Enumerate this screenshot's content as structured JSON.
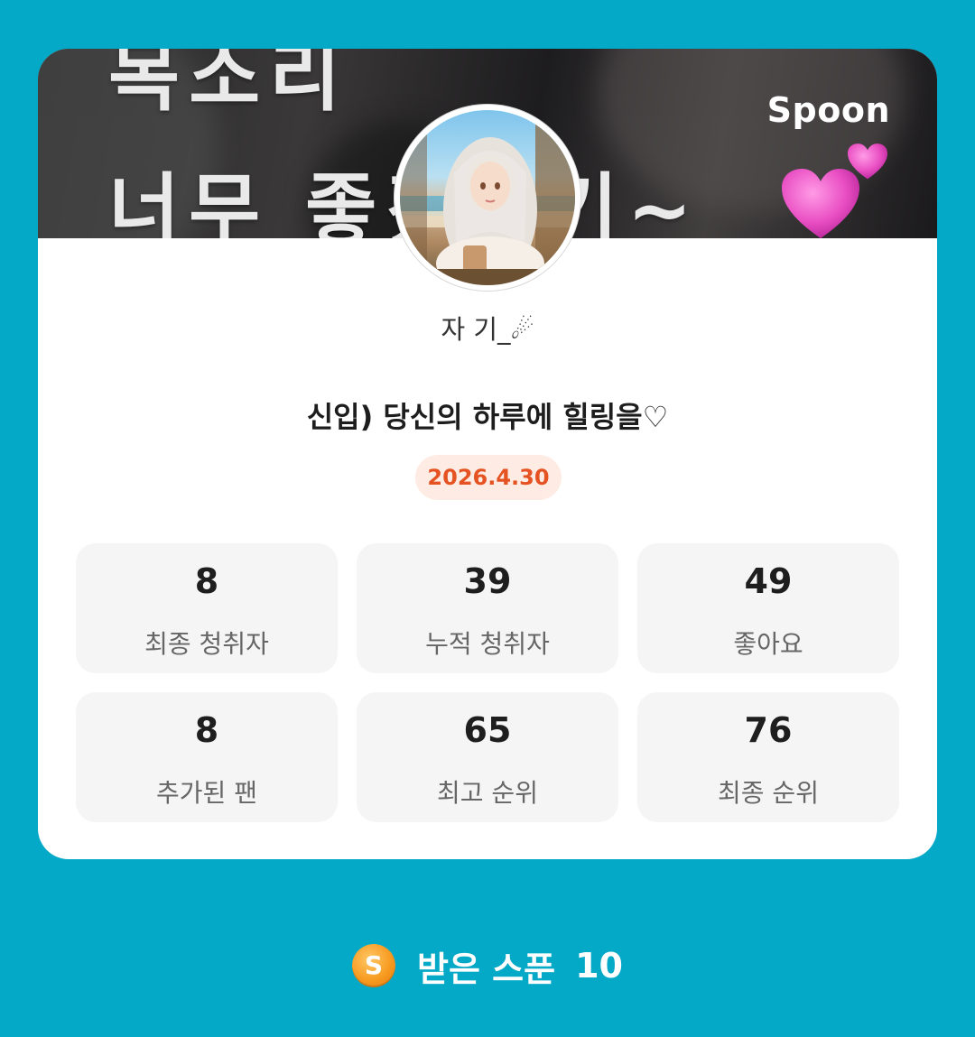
{
  "card": {
    "banner": {
      "line1": "목소리",
      "line2": "너무 좋겠쟈기~",
      "brand": "Spoon"
    },
    "nickname": "자 기_☄",
    "title": "신입) 당신의 하루에 힐링을♡",
    "date": "2026.4.30",
    "stats": [
      {
        "value": "8",
        "label": "최종 청취자"
      },
      {
        "value": "39",
        "label": "누적 청취자"
      },
      {
        "value": "49",
        "label": "좋아요"
      },
      {
        "value": "8",
        "label": "추가된 팬"
      },
      {
        "value": "65",
        "label": "최고 순위"
      },
      {
        "value": "76",
        "label": "최종 순위"
      }
    ]
  },
  "footer": {
    "coin_letter": "S",
    "label": "받은 스푼",
    "count": "10"
  },
  "colors": {
    "background": "#04a9c7",
    "date_text": "#e45321",
    "date_bg": "#fdebe4",
    "coin": "#f79b21",
    "heart": "#e94fc3"
  },
  "icons": [
    "heart-icon",
    "spoon-coin-icon"
  ]
}
